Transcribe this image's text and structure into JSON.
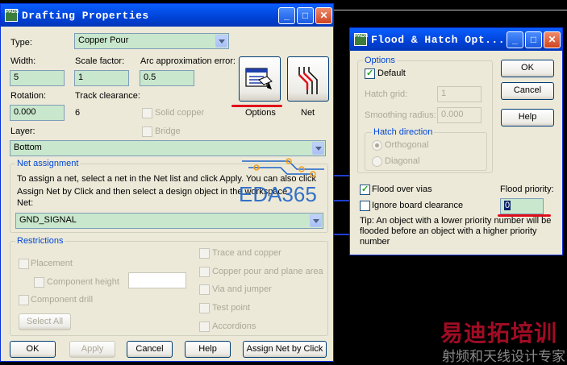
{
  "background": {
    "color": "#000000"
  },
  "drafting": {
    "title": "Drafting Properties",
    "title_icon": "PADS",
    "type_label": "Type:",
    "type_value": "Copper Pour",
    "width_label": "Width:",
    "width_value": "5",
    "scale_label": "Scale factor:",
    "scale_value": "1",
    "arc_label": "Arc approximation error:",
    "arc_value": "0.5",
    "rotation_label": "Rotation:",
    "rotation_value": "0.000",
    "track_label": "Track clearance:",
    "track_value": "6",
    "solid_copper": "Solid copper",
    "bridge": "Bridge",
    "options_label": "Options",
    "net_label": "Net",
    "layer_label": "Layer:",
    "layer_value": "Bottom",
    "net_assignment_title": "Net assignment",
    "net_assignment_text": "To assign a net, select a net in the Net list and click Apply. You can also click Assign Net by Click and then select a design object in the workspace.",
    "net_field_label": "Net:",
    "net_value": "GND_SIGNAL",
    "restrictions_title": "Restrictions",
    "placement": "Placement",
    "component_height": "Component height",
    "component_drill": "Component drill",
    "select_all": "Select All",
    "trace_and_copper": "Trace and copper",
    "copper_pour": "Copper pour and plane area",
    "via_and_jumper": "Via and jumper",
    "test_point": "Test point",
    "accordions": "Accordions",
    "ok": "OK",
    "apply": "Apply",
    "cancel": "Cancel",
    "help": "Help",
    "assign_net": "Assign Net by Click"
  },
  "flood": {
    "title": "Flood & Hatch Opt...",
    "options_title": "Options",
    "default_label": "Default",
    "hatch_grid_label": "Hatch grid:",
    "hatch_grid_value": "1",
    "smoothing_label": "Smoothing radius:",
    "smoothing_value": "0.000",
    "hatch_direction_title": "Hatch direction",
    "orthogonal": "Orthogonal",
    "diagonal": "Diagonal",
    "flood_over_vias": "Flood over vias",
    "ignore_board": "Ignore board clearance",
    "flood_priority_label": "Flood priority:",
    "flood_priority_value": "0",
    "tip": "Tip: An object with a lower priority number will be flooded before an object with a higher priority number",
    "ok": "OK",
    "cancel": "Cancel",
    "help": "Help"
  },
  "watermarks": {
    "eda365": "EDA365",
    "cn_title": "易迪拓培训",
    "cn_sub": "射频和天线设计专家"
  },
  "colors": {
    "annotation_red": "#e0101a",
    "watermark_blue": "#1f64c8",
    "watermark_red": "#c8102e"
  }
}
